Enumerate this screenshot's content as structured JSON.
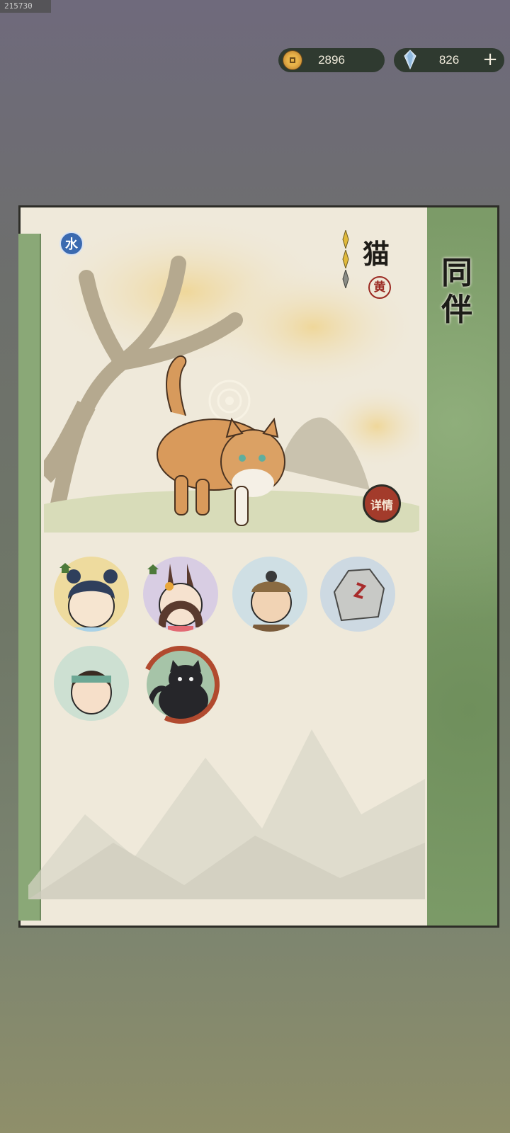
{
  "build_tag": "215730",
  "currencies": {
    "coins": "2896",
    "gems": "826",
    "add_label": "+"
  },
  "panel_title": "同\n伴",
  "pet": {
    "name": "猫",
    "element": "水",
    "rarity": "黄",
    "stars_filled": 2,
    "stars_total": 3,
    "details_label": "详情"
  },
  "companions": [
    {
      "name": "girl-blue-hair"
    },
    {
      "name": "girl-bunny-ears"
    },
    {
      "name": "old-man"
    },
    {
      "name": "stone-golem"
    },
    {
      "name": "girl-headband"
    },
    {
      "name": "black-cat"
    }
  ],
  "colors": {
    "paper": "#efe9da",
    "bamboo_green": "#7c9b68",
    "seal_red": "#a33b2b",
    "element_blue": "#3b6ab0"
  }
}
